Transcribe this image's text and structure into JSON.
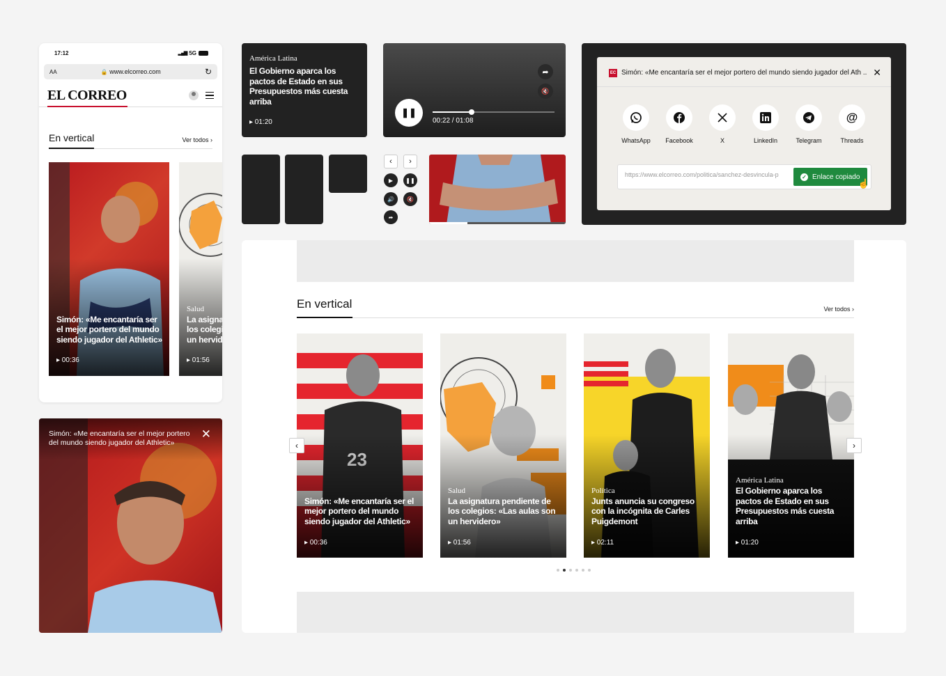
{
  "colors": {
    "accent_red": "#c8102e",
    "dark": "#222222",
    "success_green": "#1f8a3e",
    "bg": "#f4f4f4"
  },
  "phone": {
    "time": "17:12",
    "network": "5G",
    "aa": "AA",
    "url": "www.elcorreo.com",
    "logo": "EL CORREO",
    "section_title": "En vertical",
    "see_all": "Ver todos ›",
    "cards": [
      {
        "title": "Simón: «Me encantaría ser el mejor portero del mundo siendo jugador del Athletic»",
        "duration": "▸ 00:36"
      },
      {
        "category": "Salud",
        "title": "La asignatura pendiente de los colegios: «Las aulas son un hervidero»",
        "title_visible": "La asigna los colegi un hervid",
        "duration": "▸ 01:56"
      }
    ]
  },
  "fullscreen": {
    "title": "Simón: «Me encantaría ser el mejor portero del mundo siendo jugador del Athletic»",
    "close_icon": "close-icon"
  },
  "mini_card": {
    "category": "América Latina",
    "title": "El Gobierno aparca los pactos de Estado en sus Presupuestos más cuesta arriba",
    "duration": "▸ 01:20"
  },
  "player": {
    "time": "00:22 / 01:08",
    "progress": 0.32
  },
  "share": {
    "badge": "EC",
    "title": "Simón: «Me encantaría ser el mejor portero del mundo siendo jugador del Ath ...",
    "networks": [
      {
        "label": "WhatsApp",
        "icon": "whatsapp-icon"
      },
      {
        "label": "Facebook",
        "icon": "facebook-icon"
      },
      {
        "label": "X",
        "icon": "x-icon"
      },
      {
        "label": "LinkedIn",
        "icon": "linkedin-icon"
      },
      {
        "label": "Telegram",
        "icon": "telegram-icon"
      },
      {
        "label": "Threads",
        "icon": "threads-icon"
      }
    ],
    "url_value": "https://www.elcorreo.com/politica/sanchez-desvincula-p",
    "copied_label": "Enlace copiado"
  },
  "desktop": {
    "section_title": "En vertical",
    "see_all": "Ver todos ›",
    "cards": [
      {
        "category": "",
        "title": "Simón: «Me encantaría ser el mejor portero del mundo siendo jugador del Athletic»",
        "duration": "▸ 00:36"
      },
      {
        "category": "Salud",
        "title": "La asignatura pendiente de los colegios: «Las aulas son un hervidero»",
        "duration": "▸ 01:56"
      },
      {
        "category": "Política",
        "title": "Junts anuncia su congreso con la incógnita de Carles Puigdemont",
        "duration": "▸ 02:11"
      },
      {
        "category": "América Latina",
        "title": "El Gobierno aparca los pactos de Estado en sus Presupuestos más cuesta arriba",
        "duration": "▸ 01:20"
      }
    ],
    "pagination": {
      "total": 6,
      "active": 2
    }
  }
}
